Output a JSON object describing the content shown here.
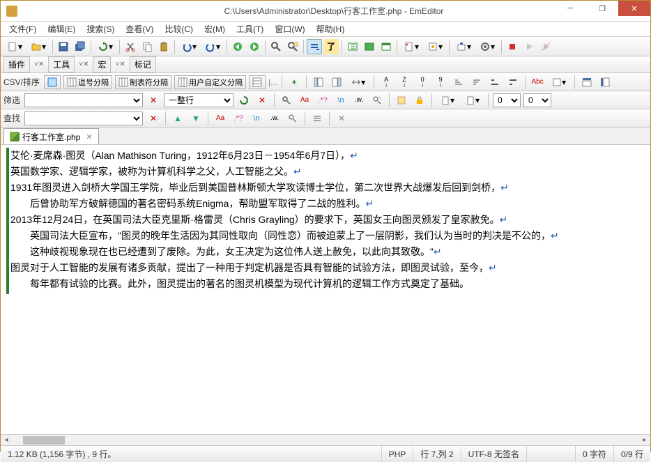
{
  "title": "C:\\Users\\Administrator\\Desktop\\行客工作室.php - EmEditor",
  "menu": [
    "文件(F)",
    "编辑(E)",
    "搜索(S)",
    "查看(V)",
    "比较(C)",
    "宏(M)",
    "工具(T)",
    "窗口(W)",
    "帮助(H)"
  ],
  "innerTabs": {
    "t1": "插件",
    "t2": "工具",
    "t3": "宏",
    "t4": "标记"
  },
  "csv": {
    "label": "CSV/排序",
    "b1": "逗号分隔",
    "b2": "制表符分隔",
    "b3": "用户自定义分隔"
  },
  "filter": {
    "label": "筛选",
    "scope": "一整行",
    "col1": "0",
    "col2": "0"
  },
  "find": {
    "label": "查找"
  },
  "fileTab": {
    "name": "行客工作室.php"
  },
  "lines": [
    "艾伦·麦席森·图灵（Alan Mathison Turing，1912年6月23日－1954年6月7日），",
    "英国数学家、逻辑学家，被称为计算机科学之父，人工智能之父。",
    "1931年图灵进入剑桥大学国王学院，毕业后到美国普林斯顿大学攻读博士学位，第二次世界大战爆发后回到剑桥，",
    "    后曾协助军方破解德国的著名密码系统Enigma，帮助盟军取得了二战的胜利。",
    "2013年12月24日，在英国司法大臣克里斯·格雷灵（Chris Grayling）的要求下，英国女王向图灵颁发了皇家赦免。",
    "    英国司法大臣宣布，\"图灵的晚年生活因为其同性取向（同性恋）而被迫蒙上了一层阴影，我们认为当时的判决是不公的，",
    "    这种歧视现象现在也已经遭到了废除。为此，女王决定为这位伟人送上赦免，以此向其致敬。\"",
    "图灵对于人工智能的发展有诸多贡献，提出了一种用于判定机器是否具有智能的试验方法，即图灵试验，至今，",
    "    每年都有试验的比赛。此外，图灵提出的著名的图灵机模型为现代计算机的逻辑工作方式奠定了基础。"
  ],
  "status": {
    "size": "1.12 KB (1,156 字节) , 9 行。",
    "lang": "PHP",
    "pos": "行 7,列 2",
    "enc": "UTF-8 无签名",
    "sel": "0 字符",
    "total": "0/9 行"
  }
}
